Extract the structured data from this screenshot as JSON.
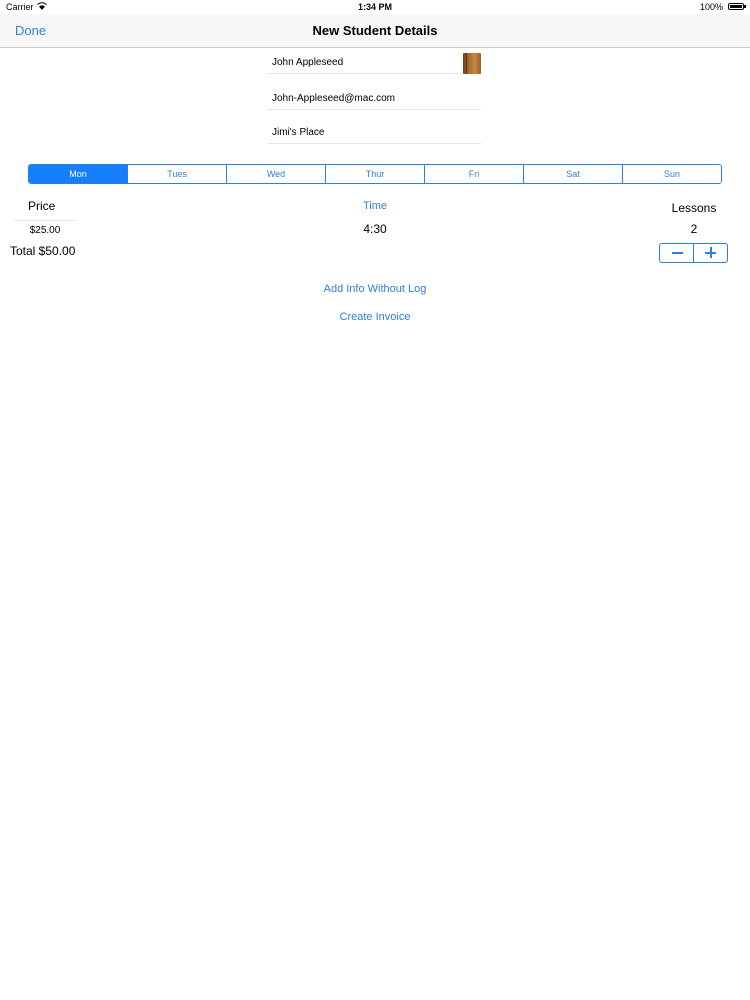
{
  "status_bar": {
    "carrier": "Carrier",
    "time": "1:34 PM",
    "battery": "100%"
  },
  "nav": {
    "done_label": "Done",
    "title": "New Student Details"
  },
  "form": {
    "name": "John Appleseed",
    "email": "John-Appleseed@mac.com",
    "location": "Jimi's Place"
  },
  "days": [
    "Mon",
    "Tues",
    "Wed",
    "Thur",
    "Fri",
    "Sat",
    "Sun"
  ],
  "selected_day": "Mon",
  "price": {
    "label": "Price",
    "value": "$25.00",
    "total": "Total $50.00"
  },
  "time": {
    "label": "Time",
    "value": "4:30"
  },
  "lessons": {
    "label": "Lessons",
    "count": "2"
  },
  "actions": {
    "add_info": "Add Info Without Log",
    "create_invoice": "Create Invoice"
  },
  "colors": {
    "accent": "#2f7fd8",
    "selected_segment": "#147efb"
  }
}
